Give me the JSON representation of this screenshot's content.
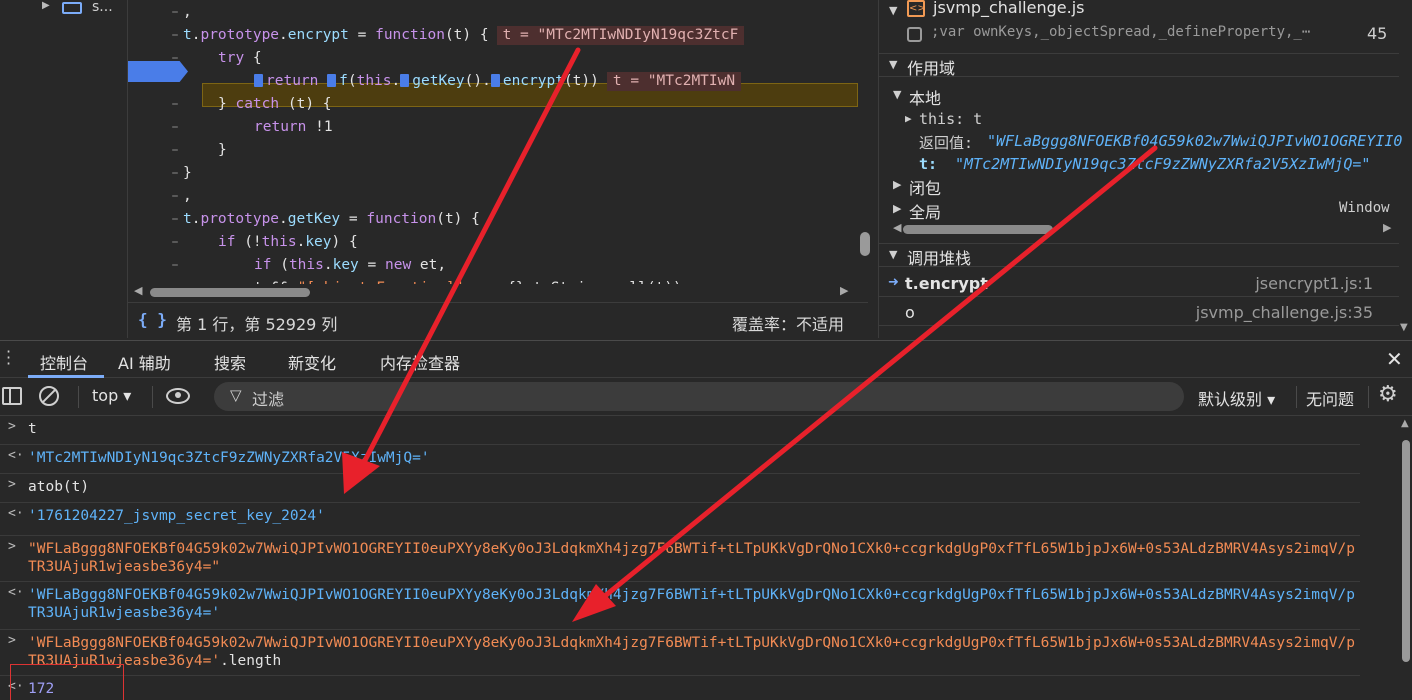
{
  "nav": {
    "item_label": "s..."
  },
  "code": {
    "lines": [
      {
        "tokens": [
          {
            "t": ",",
            "c": "pl"
          }
        ],
        "indent": 155
      },
      {
        "tokens": [
          {
            "t": "t",
            "c": "id"
          },
          {
            "t": ".",
            "c": "pl"
          },
          {
            "t": "prototype",
            "c": "kw"
          },
          {
            "t": ".",
            "c": "pl"
          },
          {
            "t": "encrypt",
            "c": "id"
          },
          {
            "t": " = ",
            "c": "pl"
          },
          {
            "t": "function",
            "c": "kw"
          },
          {
            "t": "(t) {",
            "c": "pl"
          }
        ],
        "indent": 155,
        "inline": "t = \"MTc2MTIwNDIyN19qc3ZtcF"
      },
      {
        "tokens": [
          {
            "t": "try",
            "c": "kw"
          },
          {
            "t": " {",
            "c": "pl"
          }
        ],
        "indent": 190
      },
      {
        "tokens": [
          {
            "t": "return",
            "c": "kw"
          },
          {
            "t": " ",
            "c": "pl"
          },
          {
            "t": "f",
            "c": "id"
          },
          {
            "t": "(",
            "c": "pl"
          },
          {
            "t": "this",
            "c": "kw"
          },
          {
            "t": ".",
            "c": "pl"
          },
          {
            "t": "getKey",
            "c": "id"
          },
          {
            "t": "().",
            "c": "pl"
          },
          {
            "t": "encrypt",
            "c": "id"
          },
          {
            "t": "(t))",
            "c": "pl"
          }
        ],
        "indent": 226,
        "inline": "t = \"MTc2MTIwN",
        "steps": true
      },
      {
        "tokens": [
          {
            "t": "} ",
            "c": "pl"
          },
          {
            "t": "catch",
            "c": "kw"
          },
          {
            "t": " (t) {",
            "c": "pl"
          }
        ],
        "indent": 190
      },
      {
        "tokens": [
          {
            "t": "return",
            "c": "kw"
          },
          {
            "t": " !1",
            "c": "pl"
          }
        ],
        "indent": 226
      },
      {
        "tokens": [
          {
            "t": "}",
            "c": "pl"
          }
        ],
        "indent": 190
      },
      {
        "tokens": [
          {
            "t": "}",
            "c": "pl"
          }
        ],
        "indent": 155
      },
      {
        "tokens": [
          {
            "t": ",",
            "c": "pl"
          }
        ],
        "indent": 155
      },
      {
        "tokens": [
          {
            "t": "t",
            "c": "id"
          },
          {
            "t": ".",
            "c": "pl"
          },
          {
            "t": "prototype",
            "c": "kw"
          },
          {
            "t": ".",
            "c": "pl"
          },
          {
            "t": "getKey",
            "c": "id"
          },
          {
            "t": " = ",
            "c": "pl"
          },
          {
            "t": "function",
            "c": "kw"
          },
          {
            "t": "(t) {",
            "c": "pl"
          }
        ],
        "indent": 155
      },
      {
        "tokens": [
          {
            "t": "if",
            "c": "kw"
          },
          {
            "t": " (!",
            "c": "pl"
          },
          {
            "t": "this",
            "c": "kw"
          },
          {
            "t": ".",
            "c": "pl"
          },
          {
            "t": "key",
            "c": "id"
          },
          {
            "t": ") {",
            "c": "pl"
          }
        ],
        "indent": 190
      },
      {
        "tokens": [
          {
            "t": "if",
            "c": "kw"
          },
          {
            "t": " (",
            "c": "pl"
          },
          {
            "t": "this",
            "c": "kw"
          },
          {
            "t": ".",
            "c": "pl"
          },
          {
            "t": "key",
            "c": "id"
          },
          {
            "t": " = ",
            "c": "pl"
          },
          {
            "t": "new",
            "c": "kw"
          },
          {
            "t": " et,",
            "c": "pl"
          }
        ],
        "indent": 226
      },
      {
        "tokens": [
          {
            "t": "t && ",
            "c": "pl"
          },
          {
            "t": "\"[object Function]\"",
            "c": "str"
          },
          {
            "t": " === {}.toString.call(t))",
            "c": "pl"
          }
        ],
        "indent": 226
      }
    ]
  },
  "status": {
    "braces": "{ }",
    "position": "第 1 行，第 52929 列",
    "coverage": "覆盖率：不适用"
  },
  "debugger": {
    "watch_file": "jsvmp_challenge.js",
    "watch_snippet": ";var ownKeys,_objectSpread,_defineProperty,_⋯",
    "watch_count": "45",
    "scope_title": "作用域",
    "local_label": "本地",
    "this_label": "this: t",
    "return_label": "返回值: ",
    "return_value": "\"WFLaBggg8NFOEKBf04G59k02w7WwiQJPIvWO1OGREYII0",
    "t_label": "t: ",
    "t_value": "\"MTc2MTIwNDIyN19qc3ZtcF9zZWNyZXRfa2V5XzIwMjQ=\"",
    "closure_label": "闭包",
    "global_label": "全局",
    "global_value": "Window",
    "stack_title": "调用堆栈",
    "stack": [
      {
        "fn": "t.encrypt",
        "loc": "jsencrypt1.js:1",
        "current": true
      },
      {
        "fn": "o",
        "loc": "jsvmp_challenge.js:35",
        "current": false
      }
    ]
  },
  "drawer": {
    "tabs": [
      "控制台",
      "AI 辅助",
      "搜索",
      "新变化",
      "内存检查器"
    ],
    "close": "✕"
  },
  "toolbar": {
    "context": "top ▾",
    "filter_placeholder": "过滤",
    "levels": "默认级别 ▾",
    "issues": "无问题"
  },
  "console": {
    "rows": [
      {
        "prompt": ">",
        "text": "t",
        "kind": "c-in"
      },
      {
        "prompt": "<·",
        "text": "'MTc2MTIwNDIyN19qc3ZtcF9zZWNyZXRfa2V5XzIwMjQ='",
        "kind": "c-str"
      },
      {
        "prompt": ">",
        "text": "atob(t)",
        "kind": "c-in"
      },
      {
        "prompt": "<·",
        "text": "'1761204227_jsvmp_secret_key_2024'",
        "kind": "c-str"
      },
      {
        "prompt": ">",
        "text": "\"WFLaBggg8NFOEKBf04G59k02w7WwiQJPIvWO1OGREYII0euPXYy8eKy0oJ3LdqkmXh4jzg7F6BWTif+tLTpUKkVgDrQNo1CXk0+ccgrkdgUgP0xfTfL65W1bjpJx6W+0s53ALdzBMRV4Asys2imqV/pTR3UAjuR1wjeasbe36y4=\"",
        "kind": "c-red"
      },
      {
        "prompt": "<·",
        "text": "'WFLaBggg8NFOEKBf04G59k02w7WwiQJPIvWO1OGREYII0euPXYy8eKy0oJ3LdqkmXh4jzg7F6BWTif+tLTpUKkVgDrQNo1CXk0+ccgrkdgUgP0xfTfL65W1bjpJx6W+0s53ALdzBMRV4Asys2imqV/pTR3UAjuR1wjeasbe36y4='",
        "kind": "c-str"
      },
      {
        "prompt": ">",
        "text": "'WFLaBggg8NFOEKBf04G59k02w7WwiQJPIvWO1OGREYII0euPXYy8eKy0oJ3LdqkmXh4jzg7F6BWTif+tLTpUKkVgDrQNo1CXk0+ccgrkdgUgP0xfTfL65W1bjpJx6W+0s53ALdzBMRV4Asys2imqV/pTR3UAjuR1wjeasbe36y4='",
        "suffix": ".length",
        "kind": "c-red"
      },
      {
        "prompt": "<·",
        "text": "172",
        "kind": "c-num"
      }
    ]
  },
  "colors": {
    "accent": "#7cacf8",
    "arrow": "#e8212b",
    "breakpoint": "#4a7de8"
  }
}
